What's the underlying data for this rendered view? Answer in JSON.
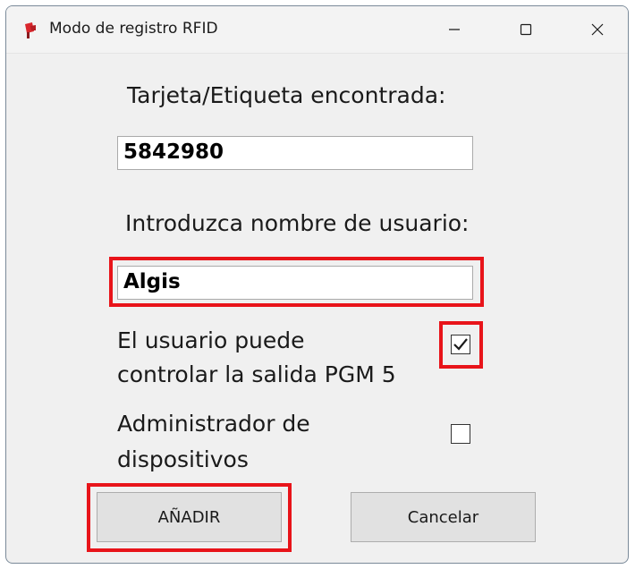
{
  "window": {
    "title": "Modo de registro RFID",
    "controls": [
      "minimize",
      "maximize",
      "close"
    ]
  },
  "form": {
    "tag_found_label": "Tarjeta/Etiqueta encontrada:",
    "tag_value": "5842980",
    "username_label": "Introduzca nombre de usuario:",
    "username_value": "Algis",
    "pgm_label_line1": "El usuario puede",
    "pgm_label_line2": "controlar la salida PGM 5",
    "pgm_checked": true,
    "admin_label_line1": "Administrador de",
    "admin_label_line2": "dispositivos",
    "admin_checked": false
  },
  "buttons": {
    "add_label": "AÑADIR",
    "cancel_label": "Cancelar"
  },
  "colors": {
    "highlight": "#e8141a",
    "window_bg": "#f0f0f0",
    "button_bg": "#e1e1e1"
  }
}
